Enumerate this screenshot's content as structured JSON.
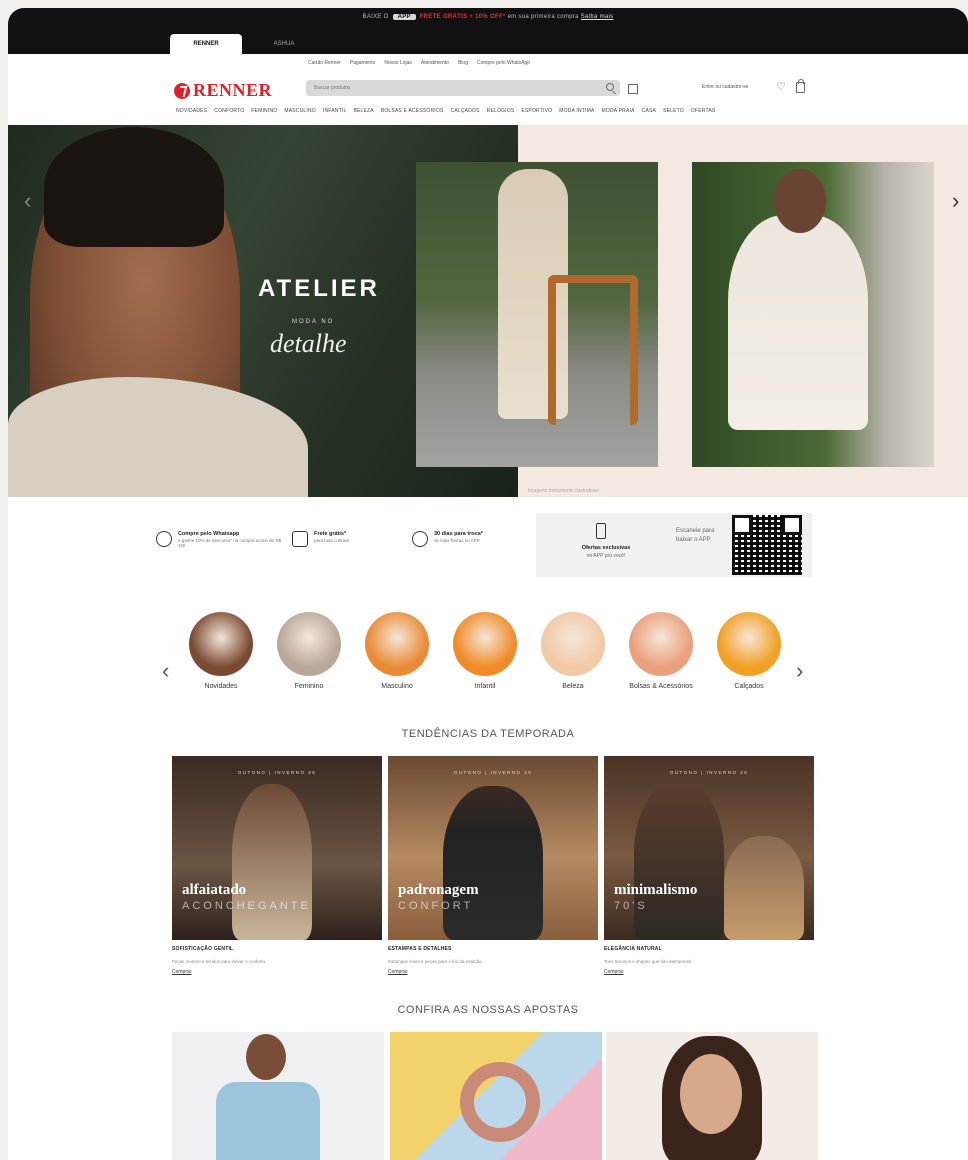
{
  "topbar": {
    "promo_prefix": "BAIXE O",
    "promo_app": "APP",
    "promo_highlight": "FRETE GRÁTIS + 10% OFF*",
    "promo_suffix": "em sua primeira compra",
    "promo_link": "Saiba mais",
    "tabs": [
      "RENNER",
      "ASHUA"
    ]
  },
  "services": [
    "Cartão Renner",
    "Pagamento",
    "Novos Lojas",
    "Atendimento",
    "Blog",
    "Compre pelo WhatsApp"
  ],
  "header": {
    "logo_text": "RENNER",
    "search_placeholder": "Buscar produtos",
    "login_text": "Entre ou cadastre-se"
  },
  "nav": [
    "NOVIDADES",
    "CONFORTO",
    "FEMININO",
    "MASCULINO",
    "INFANTIL",
    "BELEZA",
    "BOLSAS E ACESSÓRIOS",
    "CALÇADOS",
    "RELÓGIOS",
    "ESPORTIVO",
    "MODA ÍNTIMA",
    "MODA PRAIA",
    "CASA",
    "SELETO",
    "OFERTAS"
  ],
  "hero": {
    "title": "ATELIER",
    "subtitle_small": "MODA NO",
    "subtitle_script": "detalhe",
    "caption": "Imagens meramente ilustrativas"
  },
  "benefits": [
    {
      "title": "Compre pelo Whatsapp",
      "desc": "e ganhe 10% de desconto* na compra acima de R$ 150",
      "icon": "whatsapp-icon"
    },
    {
      "title": "Frete grátis*",
      "desc": "para todo o Brasil",
      "icon": "truck-icon"
    },
    {
      "title": "30 dias para troca*",
      "desc": "de lojas físicas ou APP",
      "icon": "exchange-icon"
    }
  ],
  "app_box": {
    "title": "Ofertas exclusivas",
    "desc": "no APP pra você!",
    "scan_text": "Escaneie para baixar o APP"
  },
  "categories": [
    {
      "label": "Novidades",
      "color": "#7a4a33"
    },
    {
      "label": "Feminino",
      "color": "#b8a89a"
    },
    {
      "label": "Masculino",
      "color": "#e98b35"
    },
    {
      "label": "Infantil",
      "color": "#f08b28"
    },
    {
      "label": "Beleza",
      "color": "#f1c9a5"
    },
    {
      "label": "Bolsas & Acessórios",
      "color": "#e9a07b"
    },
    {
      "label": "Calçados",
      "color": "#f1a024"
    }
  ],
  "trends_title": "TENDÊNCIAS DA TEMPORADA",
  "trends": [
    {
      "tag": "OUTONO | INVERNO 25",
      "main": "alfaiatado",
      "sub": "ACONCHEGANTE",
      "heading": "SOFISTICAÇÃO GENTIL",
      "desc": "Peças neutras e tecidos para elevar o conforto.",
      "cta": "Comprar"
    },
    {
      "tag": "OUTONO | INVERNO 25",
      "main": "padronagem",
      "sub": "CONFORT",
      "heading": "ESTAMPAS E DETALHES",
      "desc": "Estampas leves e peças para o frio da estação.",
      "cta": "Comprar"
    },
    {
      "tag": "OUTONO | INVERNO 25",
      "main": "minimalismo",
      "sub": "70'S",
      "heading": "ELEGÂNCIA NATURAL",
      "desc": "Tons terrosos e shapes que são atemporais.",
      "cta": "Comprar"
    }
  ],
  "bets_title": "CONFIRA AS NOSSAS APOSTAS"
}
